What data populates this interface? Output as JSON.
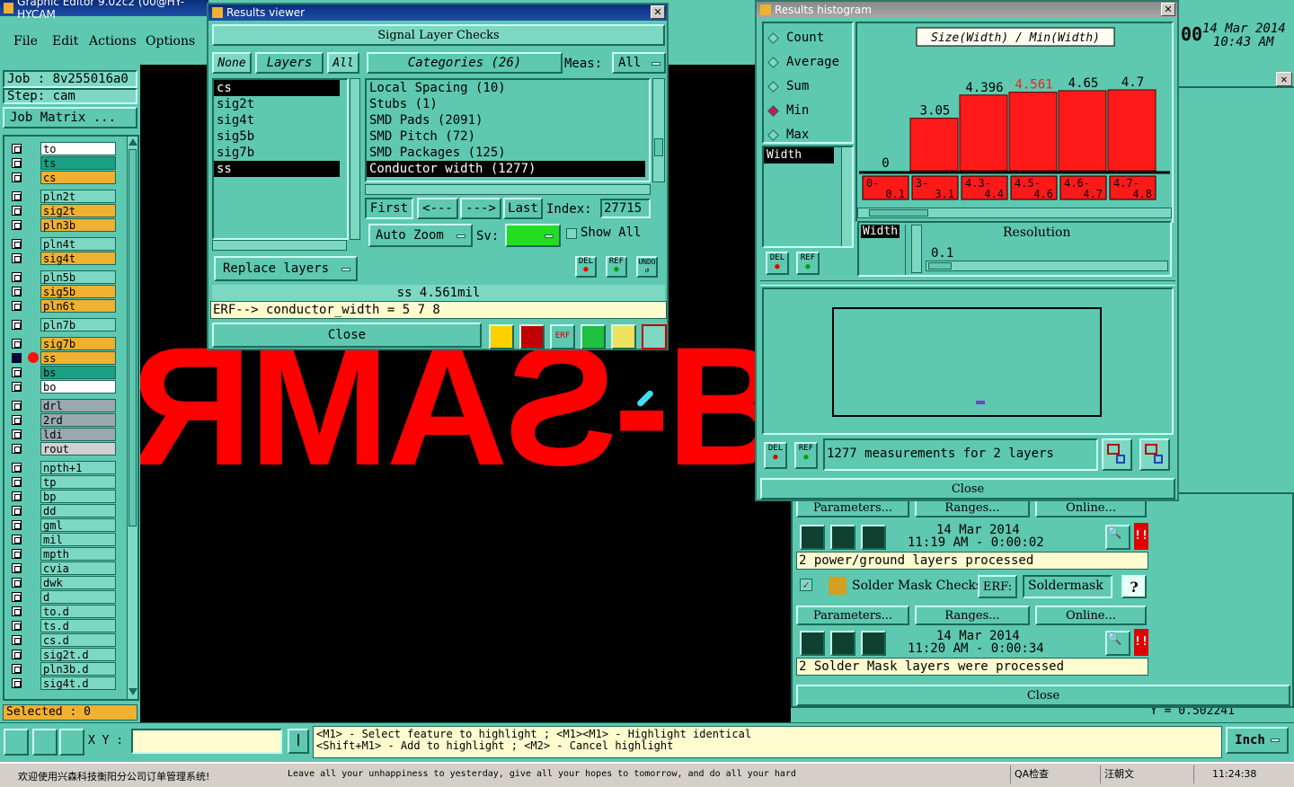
{
  "main": {
    "title": "Graphic Editor 9.02c2 (00@HY-HYCAM",
    "menu": [
      "File",
      "Edit",
      "Actions",
      "Options"
    ],
    "job_label": "Job : 8v255016a0",
    "step_label": "Step: cam",
    "job_matrix": "Job Matrix ...",
    "date": "14 Mar 2014",
    "time": "10:43 AM",
    "clock_prefix": "00",
    "selected": "Selected : 0",
    "xy_label": "X Y :",
    "hint1": "<M1> - Select feature to highlight ; <M1><M1> - Highlight identical",
    "hint2": "<Shift+M1> - Add to highlight ; <M2> - Cancel highlight",
    "units": "Inch",
    "y_readout": "Y = 0.502241",
    "canvas_text": "ЯМAƧ-B-"
  },
  "layers": [
    {
      "name": "to",
      "color": "#ffffff"
    },
    {
      "name": "ts",
      "color": "#1aa085"
    },
    {
      "name": "cs",
      "color": "#f0b030"
    },
    {
      "name": "pln2t",
      "color": "#7dd8c3"
    },
    {
      "name": "sig2t",
      "color": "#f0b030"
    },
    {
      "name": "pln3b",
      "color": "#f0b030"
    },
    {
      "name": "pln4t",
      "color": "#7dd8c3"
    },
    {
      "name": "sig4t",
      "color": "#f0b030"
    },
    {
      "name": "pln5b",
      "color": "#7dd8c3"
    },
    {
      "name": "sig5b",
      "color": "#f0b030"
    },
    {
      "name": "pln6t",
      "color": "#f0b030"
    },
    {
      "name": "pln7b",
      "color": "#7dd8c3"
    },
    {
      "name": "sig7b",
      "color": "#f0b030"
    },
    {
      "name": "ss",
      "color": "#f0b030"
    },
    {
      "name": "bs",
      "color": "#1aa085"
    },
    {
      "name": "bo",
      "color": "#ffffff"
    },
    {
      "name": "drl",
      "color": "#9aa8b0"
    },
    {
      "name": "2rd",
      "color": "#9aa8b0"
    },
    {
      "name": "ldi",
      "color": "#9aa8b0"
    },
    {
      "name": "rout",
      "color": "#d0d0d0"
    },
    {
      "name": "npth+1",
      "color": "#7dd8c3"
    },
    {
      "name": "tp",
      "color": "#7dd8c3"
    },
    {
      "name": "bp",
      "color": "#7dd8c3"
    },
    {
      "name": "dd",
      "color": "#7dd8c3"
    },
    {
      "name": "gml",
      "color": "#7dd8c3"
    },
    {
      "name": "mil",
      "color": "#7dd8c3"
    },
    {
      "name": "mpth",
      "color": "#7dd8c3"
    },
    {
      "name": "cvia",
      "color": "#7dd8c3"
    },
    {
      "name": "dwk",
      "color": "#7dd8c3"
    },
    {
      "name": "d",
      "color": "#7dd8c3"
    },
    {
      "name": "to.d",
      "color": "#7dd8c3"
    },
    {
      "name": "ts.d",
      "color": "#7dd8c3"
    },
    {
      "name": "cs.d",
      "color": "#7dd8c3"
    },
    {
      "name": "sig2t.d",
      "color": "#7dd8c3"
    },
    {
      "name": "pln3b.d",
      "color": "#7dd8c3"
    },
    {
      "name": "sig4t.d",
      "color": "#7dd8c3"
    }
  ],
  "viewer": {
    "title": "Results viewer",
    "header": "Signal Layer Checks",
    "none": "None",
    "layers": "Layers",
    "all": "All",
    "categories": "Categories (26)",
    "meas_label": "Meas:",
    "meas_value": "All",
    "layer_list": [
      "cs",
      "sig2t",
      "sig4t",
      "sig5b",
      "sig7b",
      "ss"
    ],
    "category_list": [
      "Local Spacing (10)",
      "Stubs (1)",
      "SMD Pads (2091)",
      "SMD Pitch (72)",
      "SMD Packages (125)",
      "Conductor width (1277)"
    ],
    "first": "First",
    "prev": "<---",
    "next": "--->",
    "last": "Last",
    "index_label": "Index:",
    "index_value": "27715",
    "auto_zoom": "Auto Zoom",
    "sv": "Sv:",
    "show_all": "Show All",
    "replace_layers": "Replace layers",
    "del": "DEL",
    "ref": "REF",
    "undo": "UNDO",
    "status": "ss 4.561mil",
    "erf": "ERF--> conductor_width = 5 7 8",
    "close": "Close"
  },
  "histogram": {
    "title": "Results histogram",
    "modes": [
      "Count",
      "Average",
      "Sum",
      "Min",
      "Max"
    ],
    "selected_mode": "Min",
    "axis_list": [
      "Width"
    ],
    "resolution_label": "Resolution",
    "resolution_value": "0.1",
    "width_label": "Width",
    "summary": "1277 measurements for 2 layers",
    "close": "Close",
    "del": "DEL",
    "ref": "REF"
  },
  "chart_data": {
    "type": "bar",
    "title": "Size(Width) / Min(Width)",
    "categories": [
      "0-0.1",
      "3-3.1",
      "4.3-4.4",
      "4.5-4.6",
      "4.6-4.7",
      "4.7-4.8"
    ],
    "values": [
      0,
      3.05,
      4.396,
      4.561,
      4.65,
      4.7
    ],
    "value_labels": [
      "0",
      "3.05",
      "4.396",
      "4.561",
      "4.65",
      "4.7"
    ],
    "tick_top": [
      "0-",
      "3-",
      "4.3-",
      "4.5-",
      "4.6-",
      "4.7-"
    ],
    "tick_bottom": [
      "0.1",
      "3.1",
      "4.4",
      "4.6",
      "4.7",
      "4.8"
    ],
    "highlight_index": 3,
    "bar_color": "#ff1a1a",
    "highlight_label_color": "#ff1a1a"
  },
  "checks": {
    "parameters": "Parameters...",
    "ranges": "Ranges...",
    "online": "Online...",
    "run1_date": "14 Mar 2014",
    "run1_time": "11:19 AM - 0:00:02",
    "run1_msg": "2 power/ground layers processed",
    "sm_title": "Solder Mask Checks",
    "erf": "ERF:",
    "erf_value": "Soldermask",
    "help": "?",
    "run2_date": "14 Mar 2014",
    "run2_time": "11:20 AM - 0:00:34",
    "run2_msg": "2 Solder Mask layers were processed",
    "close": "Close"
  },
  "taskbar": {
    "welcome": "欢迎使用兴森科技衡阳分公司订单管理系统!",
    "marquee": "Leave all your unhappiness to yesterday, give all your hopes to tomorrow, and do all your hard",
    "qa": "QA检查",
    "user": "汪朝文",
    "time": "11:24:38"
  }
}
